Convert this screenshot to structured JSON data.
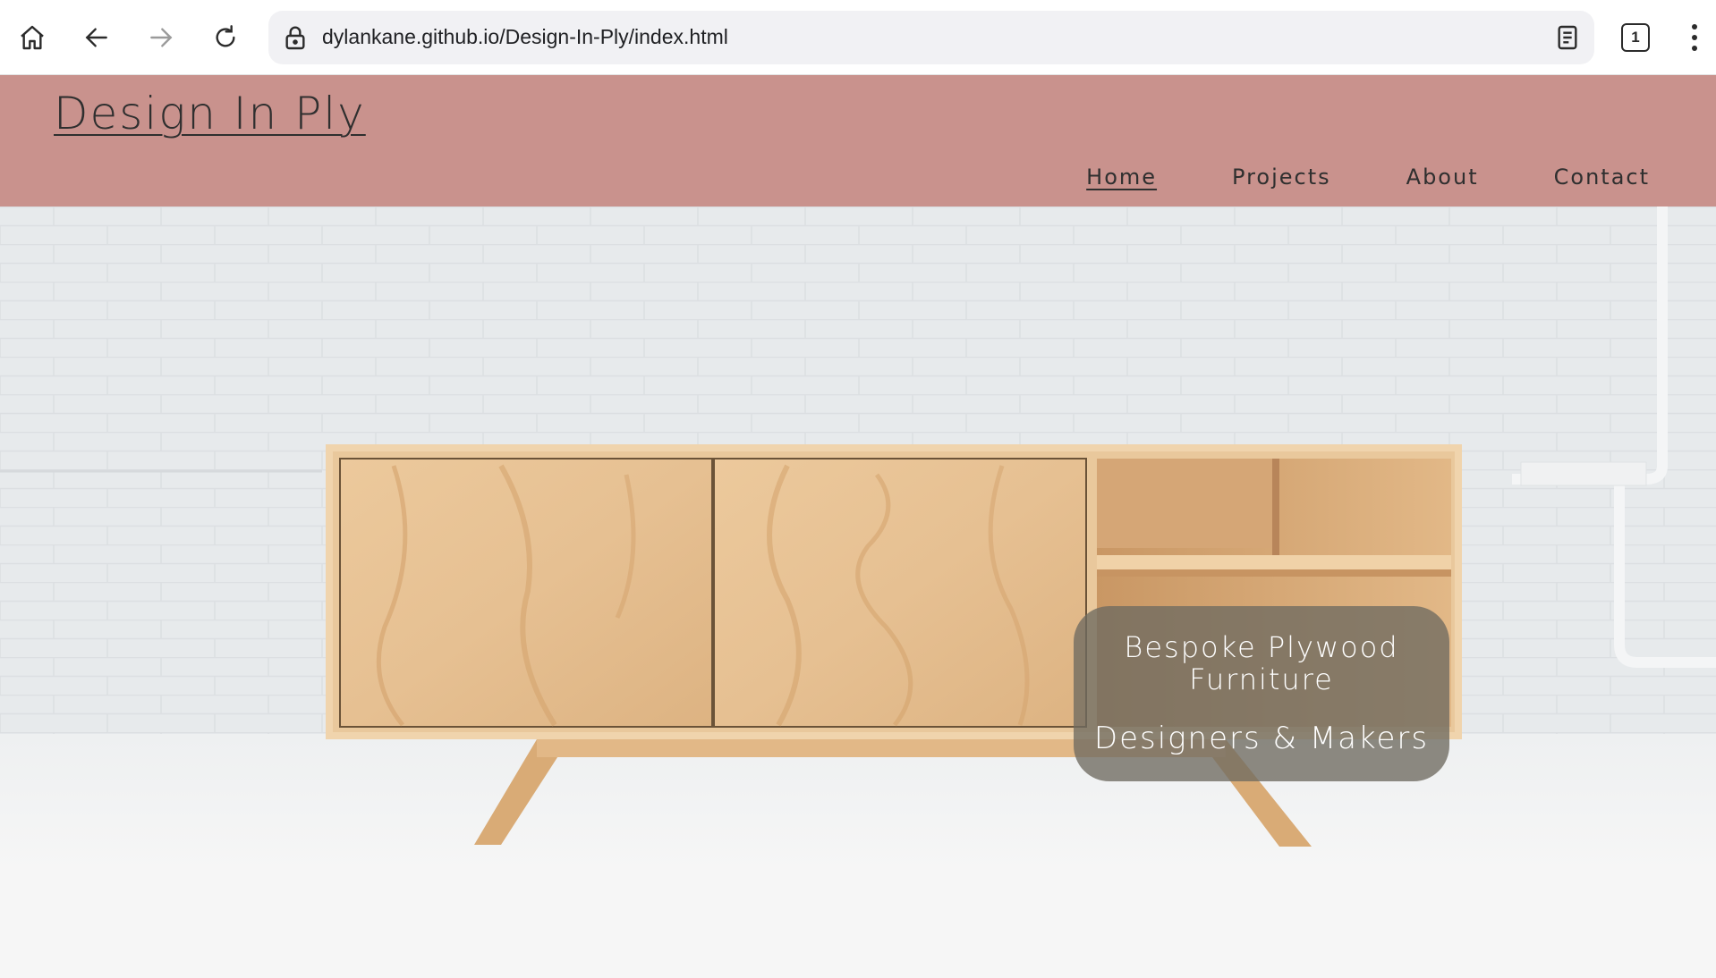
{
  "browser": {
    "url": "dylankane.github.io/Design-In-Ply/index.html",
    "tab_count": "1"
  },
  "site": {
    "logo": "Design In Ply",
    "nav": [
      {
        "label": "Home",
        "active": true
      },
      {
        "label": "Projects",
        "active": false
      },
      {
        "label": "About",
        "active": false
      },
      {
        "label": "Contact",
        "active": false
      }
    ]
  },
  "hero": {
    "tagline": "Bespoke Plywood Furniture",
    "subtitle": "Designers & Makers"
  },
  "colors": {
    "header_bg": "#c9928d",
    "card_bg": "#6e6a60",
    "wall": "#e9ecee",
    "plywood": "#e8c497"
  }
}
